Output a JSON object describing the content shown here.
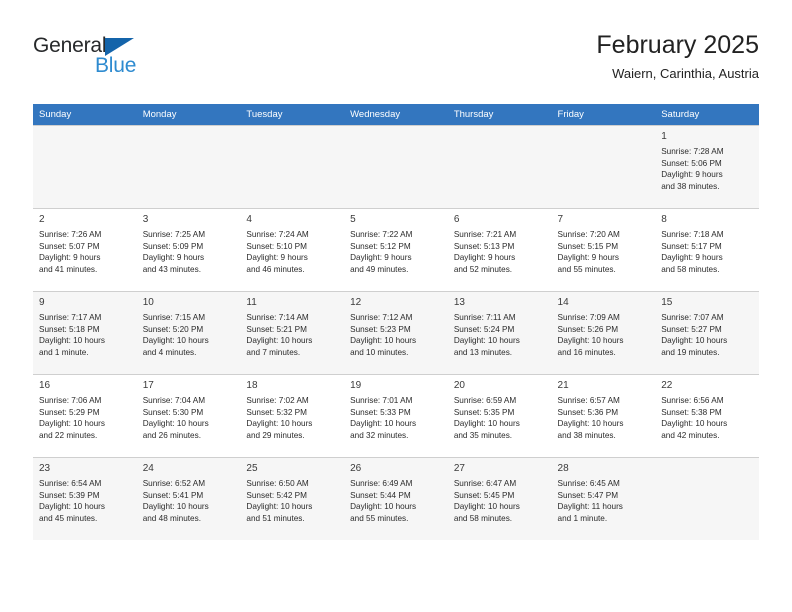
{
  "brand": {
    "name_part1": "General",
    "name_part2": "Blue",
    "triangle_color": "#1464aa",
    "blue_color": "#2e8bd0"
  },
  "header": {
    "title": "February 2025",
    "subtitle": "Waiern, Carinthia, Austria"
  },
  "theme": {
    "header_row_bg": "#3376bf",
    "header_row_text": "#ffffff",
    "shaded_row_bg": "#f6f6f6",
    "grid_line": "#cfcfcf"
  },
  "weekdays": [
    "Sunday",
    "Monday",
    "Tuesday",
    "Wednesday",
    "Thursday",
    "Friday",
    "Saturday"
  ],
  "labels": {
    "sunrise_prefix": "Sunrise:",
    "sunset_prefix": "Sunset:",
    "daylight_prefix": "Daylight:"
  },
  "weeks": [
    {
      "shaded": true,
      "days": [
        {
          "empty": true
        },
        {
          "empty": true
        },
        {
          "empty": true
        },
        {
          "empty": true
        },
        {
          "empty": true
        },
        {
          "empty": true
        },
        {
          "day": "1",
          "sunrise": "Sunrise: 7:28 AM",
          "sunset": "Sunset: 5:06 PM",
          "daylight_line1": "Daylight: 9 hours",
          "daylight_line2": "and 38 minutes."
        }
      ]
    },
    {
      "shaded": false,
      "days": [
        {
          "day": "2",
          "sunrise": "Sunrise: 7:26 AM",
          "sunset": "Sunset: 5:07 PM",
          "daylight_line1": "Daylight: 9 hours",
          "daylight_line2": "and 41 minutes."
        },
        {
          "day": "3",
          "sunrise": "Sunrise: 7:25 AM",
          "sunset": "Sunset: 5:09 PM",
          "daylight_line1": "Daylight: 9 hours",
          "daylight_line2": "and 43 minutes."
        },
        {
          "day": "4",
          "sunrise": "Sunrise: 7:24 AM",
          "sunset": "Sunset: 5:10 PM",
          "daylight_line1": "Daylight: 9 hours",
          "daylight_line2": "and 46 minutes."
        },
        {
          "day": "5",
          "sunrise": "Sunrise: 7:22 AM",
          "sunset": "Sunset: 5:12 PM",
          "daylight_line1": "Daylight: 9 hours",
          "daylight_line2": "and 49 minutes."
        },
        {
          "day": "6",
          "sunrise": "Sunrise: 7:21 AM",
          "sunset": "Sunset: 5:13 PM",
          "daylight_line1": "Daylight: 9 hours",
          "daylight_line2": "and 52 minutes."
        },
        {
          "day": "7",
          "sunrise": "Sunrise: 7:20 AM",
          "sunset": "Sunset: 5:15 PM",
          "daylight_line1": "Daylight: 9 hours",
          "daylight_line2": "and 55 minutes."
        },
        {
          "day": "8",
          "sunrise": "Sunrise: 7:18 AM",
          "sunset": "Sunset: 5:17 PM",
          "daylight_line1": "Daylight: 9 hours",
          "daylight_line2": "and 58 minutes."
        }
      ]
    },
    {
      "shaded": true,
      "days": [
        {
          "day": "9",
          "sunrise": "Sunrise: 7:17 AM",
          "sunset": "Sunset: 5:18 PM",
          "daylight_line1": "Daylight: 10 hours",
          "daylight_line2": "and 1 minute."
        },
        {
          "day": "10",
          "sunrise": "Sunrise: 7:15 AM",
          "sunset": "Sunset: 5:20 PM",
          "daylight_line1": "Daylight: 10 hours",
          "daylight_line2": "and 4 minutes."
        },
        {
          "day": "11",
          "sunrise": "Sunrise: 7:14 AM",
          "sunset": "Sunset: 5:21 PM",
          "daylight_line1": "Daylight: 10 hours",
          "daylight_line2": "and 7 minutes."
        },
        {
          "day": "12",
          "sunrise": "Sunrise: 7:12 AM",
          "sunset": "Sunset: 5:23 PM",
          "daylight_line1": "Daylight: 10 hours",
          "daylight_line2": "and 10 minutes."
        },
        {
          "day": "13",
          "sunrise": "Sunrise: 7:11 AM",
          "sunset": "Sunset: 5:24 PM",
          "daylight_line1": "Daylight: 10 hours",
          "daylight_line2": "and 13 minutes."
        },
        {
          "day": "14",
          "sunrise": "Sunrise: 7:09 AM",
          "sunset": "Sunset: 5:26 PM",
          "daylight_line1": "Daylight: 10 hours",
          "daylight_line2": "and 16 minutes."
        },
        {
          "day": "15",
          "sunrise": "Sunrise: 7:07 AM",
          "sunset": "Sunset: 5:27 PM",
          "daylight_line1": "Daylight: 10 hours",
          "daylight_line2": "and 19 minutes."
        }
      ]
    },
    {
      "shaded": false,
      "days": [
        {
          "day": "16",
          "sunrise": "Sunrise: 7:06 AM",
          "sunset": "Sunset: 5:29 PM",
          "daylight_line1": "Daylight: 10 hours",
          "daylight_line2": "and 22 minutes."
        },
        {
          "day": "17",
          "sunrise": "Sunrise: 7:04 AM",
          "sunset": "Sunset: 5:30 PM",
          "daylight_line1": "Daylight: 10 hours",
          "daylight_line2": "and 26 minutes."
        },
        {
          "day": "18",
          "sunrise": "Sunrise: 7:02 AM",
          "sunset": "Sunset: 5:32 PM",
          "daylight_line1": "Daylight: 10 hours",
          "daylight_line2": "and 29 minutes."
        },
        {
          "day": "19",
          "sunrise": "Sunrise: 7:01 AM",
          "sunset": "Sunset: 5:33 PM",
          "daylight_line1": "Daylight: 10 hours",
          "daylight_line2": "and 32 minutes."
        },
        {
          "day": "20",
          "sunrise": "Sunrise: 6:59 AM",
          "sunset": "Sunset: 5:35 PM",
          "daylight_line1": "Daylight: 10 hours",
          "daylight_line2": "and 35 minutes."
        },
        {
          "day": "21",
          "sunrise": "Sunrise: 6:57 AM",
          "sunset": "Sunset: 5:36 PM",
          "daylight_line1": "Daylight: 10 hours",
          "daylight_line2": "and 38 minutes."
        },
        {
          "day": "22",
          "sunrise": "Sunrise: 6:56 AM",
          "sunset": "Sunset: 5:38 PM",
          "daylight_line1": "Daylight: 10 hours",
          "daylight_line2": "and 42 minutes."
        }
      ]
    },
    {
      "shaded": true,
      "days": [
        {
          "day": "23",
          "sunrise": "Sunrise: 6:54 AM",
          "sunset": "Sunset: 5:39 PM",
          "daylight_line1": "Daylight: 10 hours",
          "daylight_line2": "and 45 minutes."
        },
        {
          "day": "24",
          "sunrise": "Sunrise: 6:52 AM",
          "sunset": "Sunset: 5:41 PM",
          "daylight_line1": "Daylight: 10 hours",
          "daylight_line2": "and 48 minutes."
        },
        {
          "day": "25",
          "sunrise": "Sunrise: 6:50 AM",
          "sunset": "Sunset: 5:42 PM",
          "daylight_line1": "Daylight: 10 hours",
          "daylight_line2": "and 51 minutes."
        },
        {
          "day": "26",
          "sunrise": "Sunrise: 6:49 AM",
          "sunset": "Sunset: 5:44 PM",
          "daylight_line1": "Daylight: 10 hours",
          "daylight_line2": "and 55 minutes."
        },
        {
          "day": "27",
          "sunrise": "Sunrise: 6:47 AM",
          "sunset": "Sunset: 5:45 PM",
          "daylight_line1": "Daylight: 10 hours",
          "daylight_line2": "and 58 minutes."
        },
        {
          "day": "28",
          "sunrise": "Sunrise: 6:45 AM",
          "sunset": "Sunset: 5:47 PM",
          "daylight_line1": "Daylight: 11 hours",
          "daylight_line2": "and 1 minute."
        },
        {
          "empty": true
        }
      ]
    }
  ]
}
